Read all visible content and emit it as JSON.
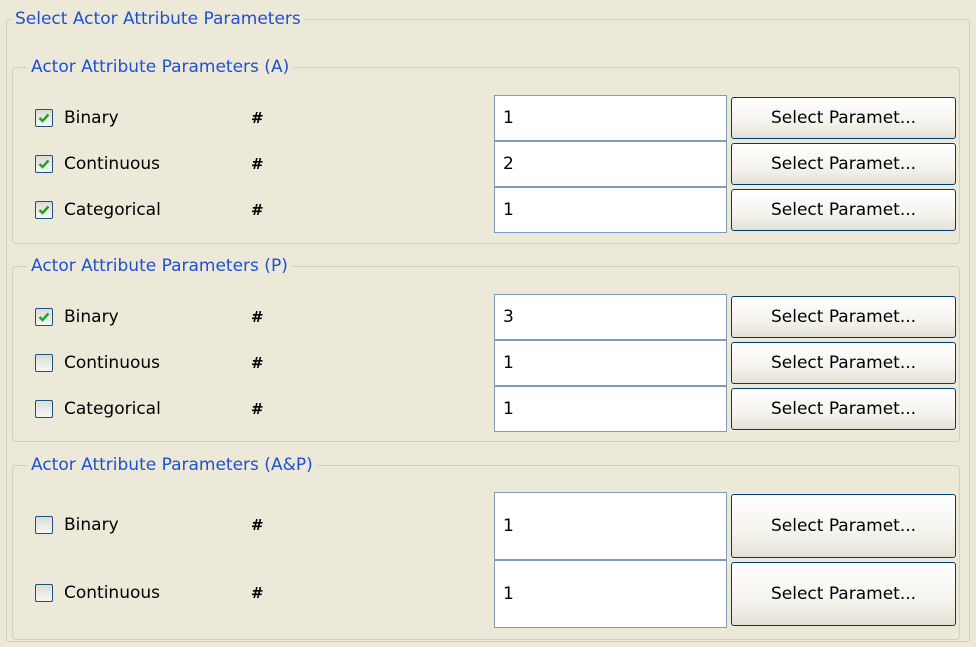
{
  "outer_title": "Select Actor Attribute Parameters",
  "groups": [
    {
      "title": "Actor Attribute Parameters (A)",
      "rows": [
        {
          "label": "Binary",
          "checked": true,
          "hash": "#",
          "value": "1",
          "button": "Select Paramet..."
        },
        {
          "label": "Continuous",
          "checked": true,
          "hash": "#",
          "value": "2",
          "button": "Select Paramet..."
        },
        {
          "label": "Categorical",
          "checked": true,
          "hash": "#",
          "value": "1",
          "button": "Select Paramet..."
        }
      ]
    },
    {
      "title": "Actor Attribute Parameters (P)",
      "rows": [
        {
          "label": "Binary",
          "checked": true,
          "hash": "#",
          "value": "3",
          "button": "Select Paramet..."
        },
        {
          "label": "Continuous",
          "checked": false,
          "hash": "#",
          "value": "1",
          "button": "Select Paramet..."
        },
        {
          "label": "Categorical",
          "checked": false,
          "hash": "#",
          "value": "1",
          "button": "Select Paramet..."
        }
      ]
    },
    {
      "title": "Actor Attribute Parameters (A&P)",
      "rows": [
        {
          "label": "Binary",
          "checked": false,
          "hash": "#",
          "value": "1",
          "button": "Select Paramet..."
        },
        {
          "label": "Continuous",
          "checked": false,
          "hash": "#",
          "value": "1",
          "button": "Select Paramet..."
        }
      ]
    }
  ],
  "colors": {
    "legend_text": "#2050d0",
    "panel_bg": "#ece9d8",
    "check_mark": "#21a121",
    "input_border": "#7f9db9",
    "button_border": "#003c74"
  }
}
